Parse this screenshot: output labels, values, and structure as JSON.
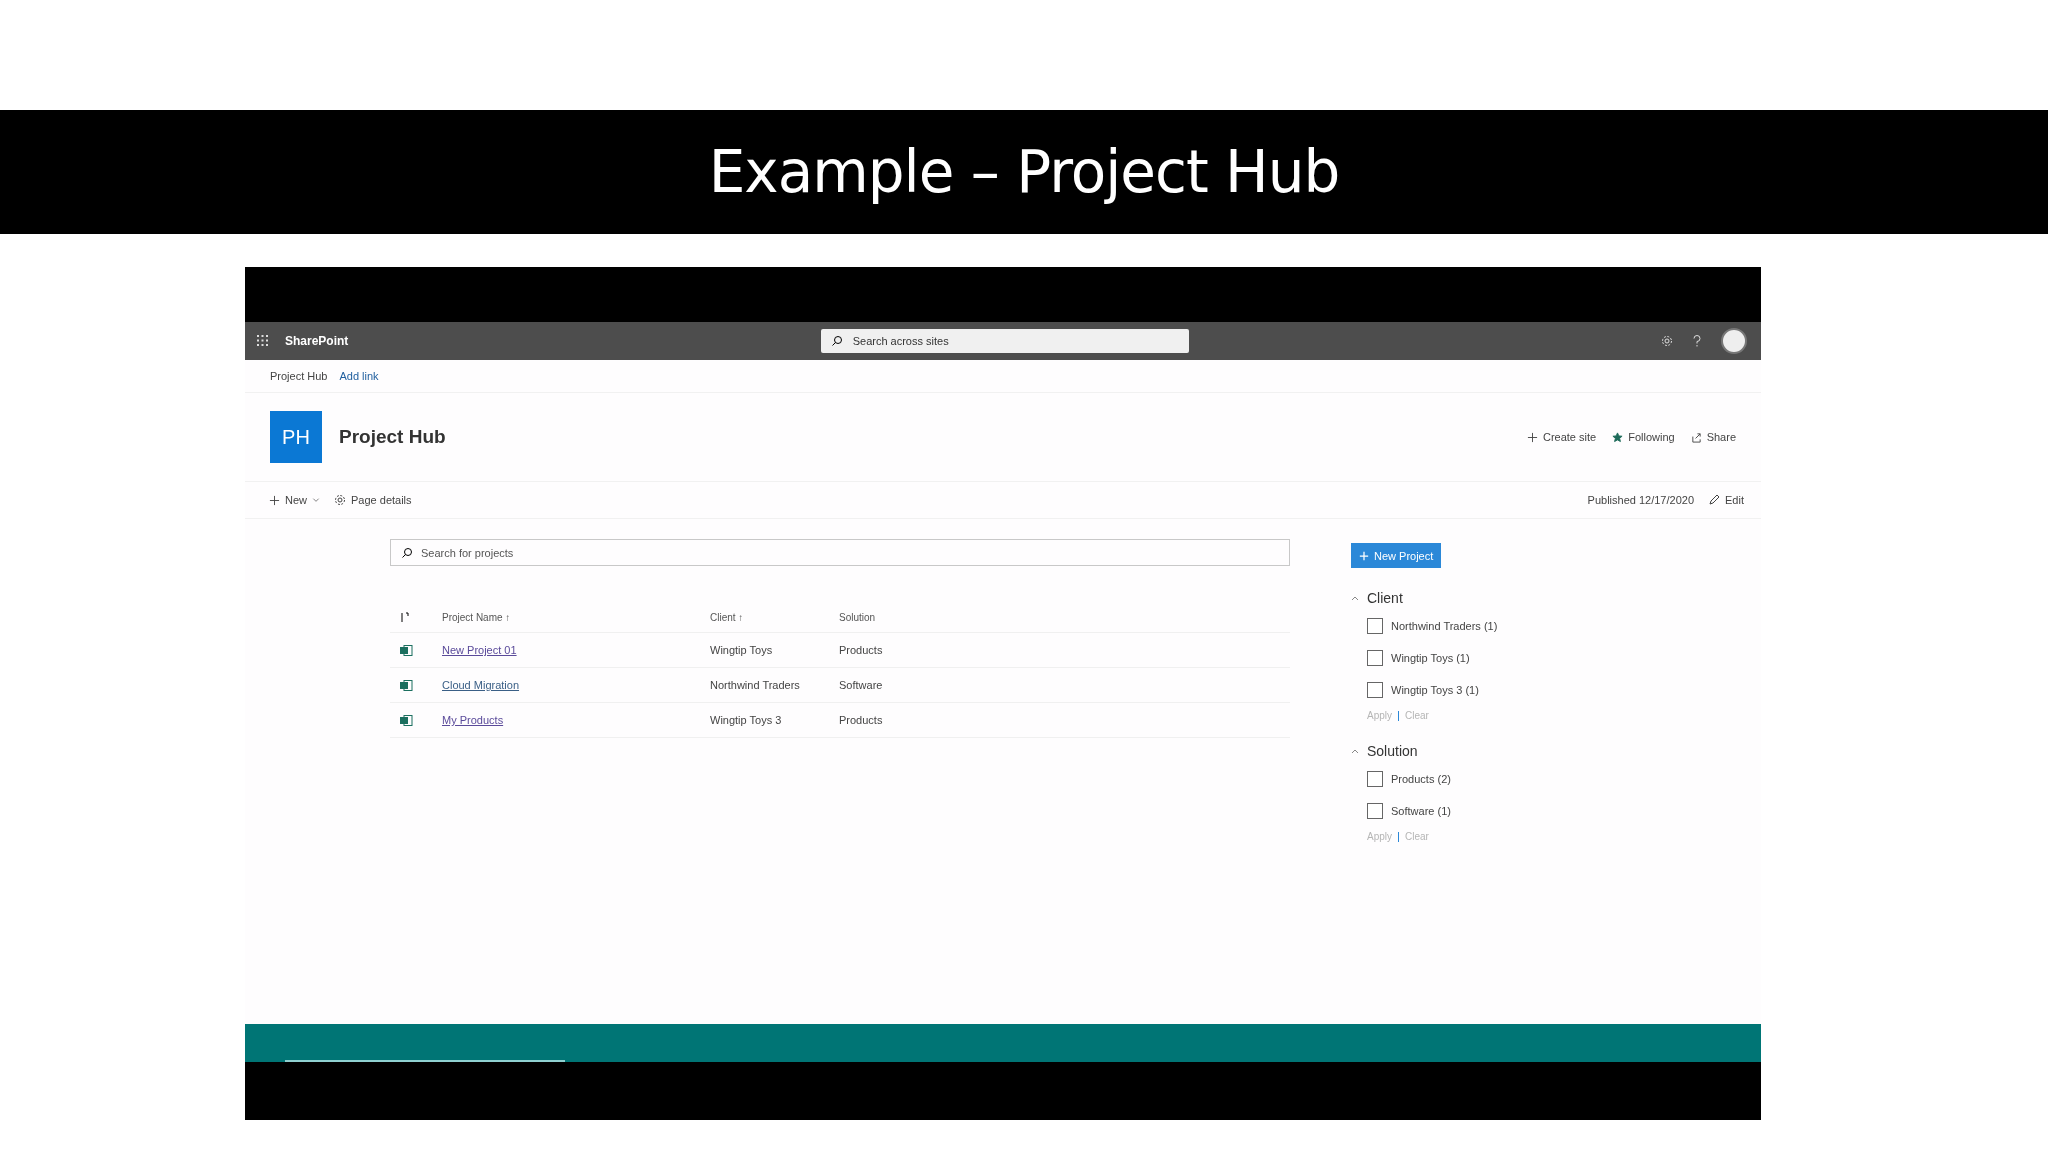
{
  "slide_title": "Example – Project Hub",
  "suite_bar": {
    "app_name": "SharePoint",
    "search": {
      "placeholder": "Search across sites"
    }
  },
  "breadcrumb": [
    {
      "label": "Project Hub",
      "selected": true
    },
    {
      "label": "Add link",
      "selected": false
    }
  ],
  "site_header": {
    "logo": "PH",
    "title": "Project Hub",
    "actions": [
      {
        "label": "Create site",
        "kind": "plus"
      },
      {
        "label": "Following",
        "kind": "star"
      },
      {
        "label": "Share",
        "kind": "share"
      }
    ]
  },
  "command_bar": {
    "left": [
      {
        "label": "New",
        "kind": "new"
      },
      {
        "label": "Page details",
        "kind": "gear"
      }
    ],
    "published": "Published 12/17/2020",
    "edit": "Edit"
  },
  "projects": {
    "search": {
      "placeholder": "Search for projects"
    },
    "columns": [
      "Project Name ↑",
      "Client ↑",
      "Solution"
    ],
    "rows": [
      {
        "cells": [
          "New Project 01",
          "Wingtip Toys",
          "Products"
        ],
        "visited": true
      },
      {
        "cells": [
          "Cloud Migration",
          "Northwind Traders",
          "Software"
        ],
        "visited": false
      },
      {
        "cells": [
          "My Products",
          "Wingtip Toys 3",
          "Products"
        ],
        "visited": true
      }
    ]
  },
  "new_project_button": "New Project",
  "filters": [
    {
      "title": "Client",
      "expanded": true,
      "options": [
        {
          "label": "Northwind Traders (1)",
          "checked": false
        },
        {
          "label": "Wingtip Toys (1)",
          "checked": false
        },
        {
          "label": "Wingtip Toys 3 (1)",
          "checked": false
        }
      ],
      "apply": "Apply",
      "clear": "Clear"
    },
    {
      "title": "Solution",
      "expanded": true,
      "options": [
        {
          "label": "Products (2)",
          "checked": false
        },
        {
          "label": "Software (1)",
          "checked": false
        }
      ],
      "apply": "Apply",
      "clear": "Clear"
    }
  ]
}
